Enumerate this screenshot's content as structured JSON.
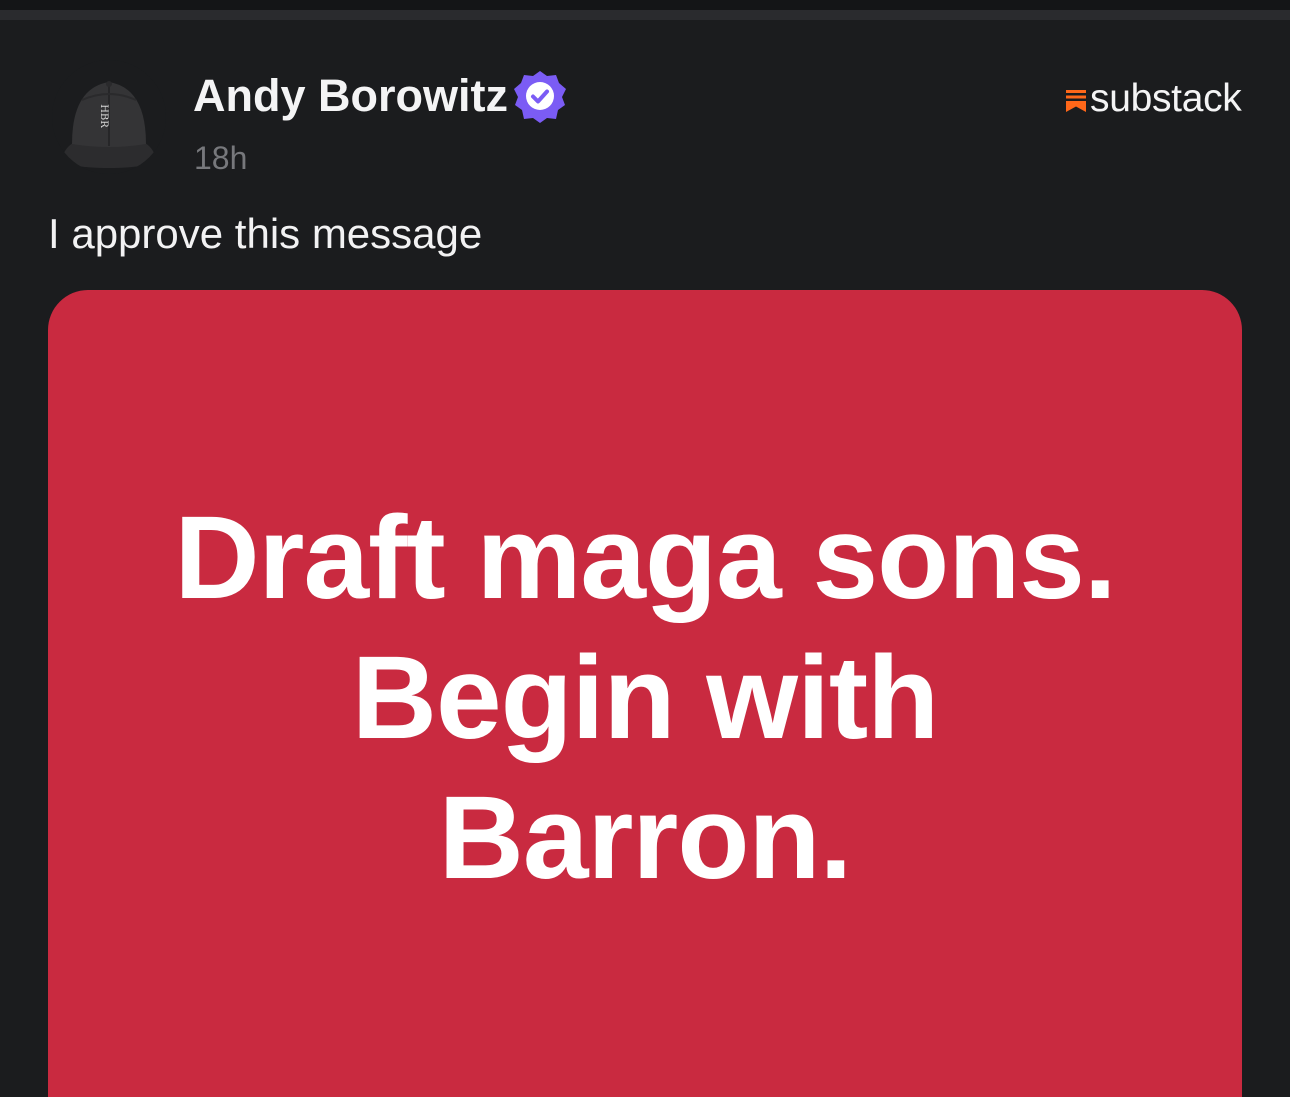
{
  "post": {
    "author": "Andy Borowitz",
    "verified": true,
    "timestamp": "18h",
    "platform": "substack",
    "body": "I approve this message",
    "image": {
      "lines": [
        "Draft maga sons.",
        "Begin with",
        "Barron."
      ],
      "background": "#c92a40"
    }
  },
  "colors": {
    "background": "#1b1c1e",
    "verified_badge": "#7b5cf5",
    "substack_brand": "#ff6719",
    "muted_text": "#77787c"
  },
  "icons": {
    "avatar": "cap-avatar",
    "verified": "verified-check-icon",
    "platform": "substack-icon"
  }
}
